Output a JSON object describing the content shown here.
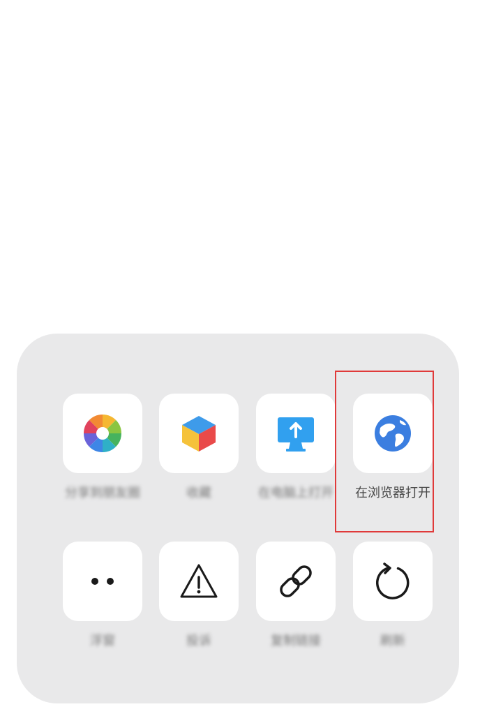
{
  "share_panel": {
    "row1": [
      {
        "label": "分享到朋友圈",
        "icon": "shutter-icon"
      },
      {
        "label": "收藏",
        "icon": "cube-icon"
      },
      {
        "label": "在电脑上打开",
        "icon": "monitor-upload-icon"
      },
      {
        "label": "在浏览器打开",
        "icon": "globe-icon"
      }
    ],
    "row2": [
      {
        "label": "浮窗",
        "icon": "dots-icon"
      },
      {
        "label": "投诉",
        "icon": "warning-icon"
      },
      {
        "label": "复制链接",
        "icon": "link-icon"
      },
      {
        "label": "刷新",
        "icon": "refresh-icon"
      }
    ]
  },
  "colors": {
    "panel_bg": "#e9e9ea",
    "tile_bg": "#ffffff",
    "highlight": "#e03a3a",
    "globe": "#3b7ee0"
  }
}
